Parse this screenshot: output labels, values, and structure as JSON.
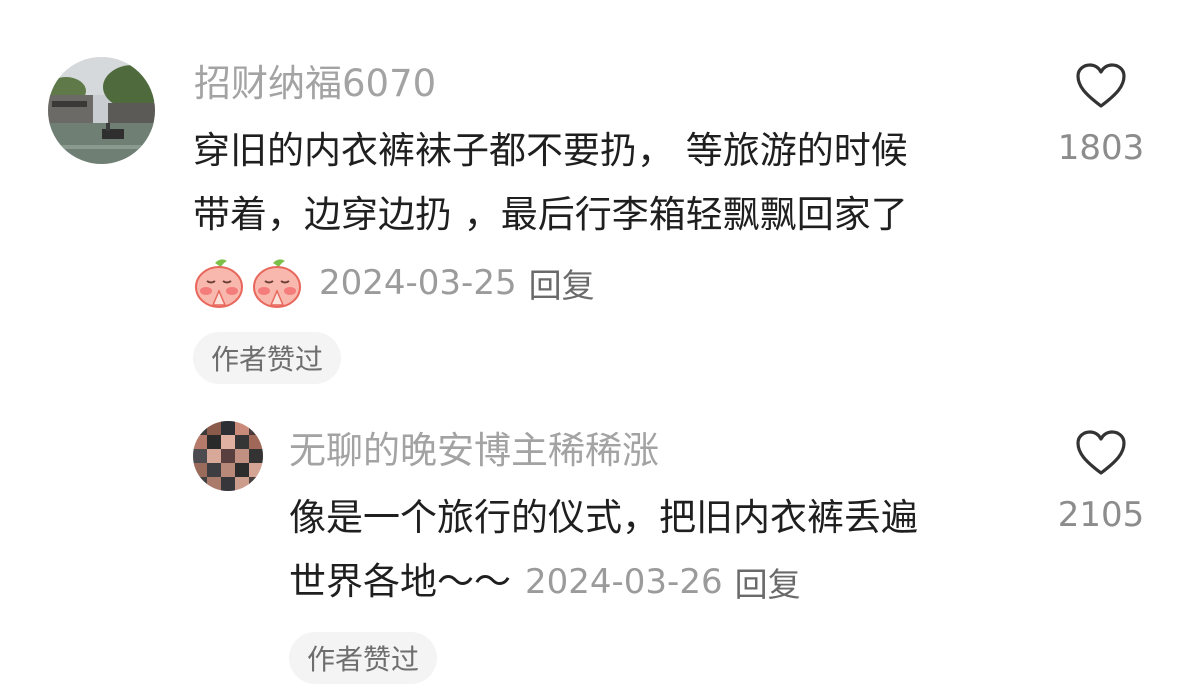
{
  "comments": [
    {
      "username": "招财纳福6070",
      "text_line1": "穿旧的内衣裤袜子都不要扔， 等旅游的时候",
      "text_line2": "带着，边穿边扔 ，最后行李箱轻飘飘回家了",
      "date": "2024-03-25",
      "reply_label": "回复",
      "badge": "作者赞过",
      "like_count": "1803",
      "emoji_icons": [
        "pray-emoji-icon",
        "pray-emoji-icon"
      ]
    },
    {
      "username": "无聊的晚安博主稀稀涨",
      "text_line1": "像是一个旅行的仪式，把旧内衣裤丢遍",
      "text_line2": "世界各地～～",
      "date": "2024-03-26",
      "reply_label": "回复",
      "badge": "作者赞过",
      "like_count": "2105"
    }
  ],
  "colors": {
    "username": "#a3a3a3",
    "text": "#1f1f1f",
    "date": "#9b9b9b",
    "badge_bg": "#f4f4f4"
  }
}
